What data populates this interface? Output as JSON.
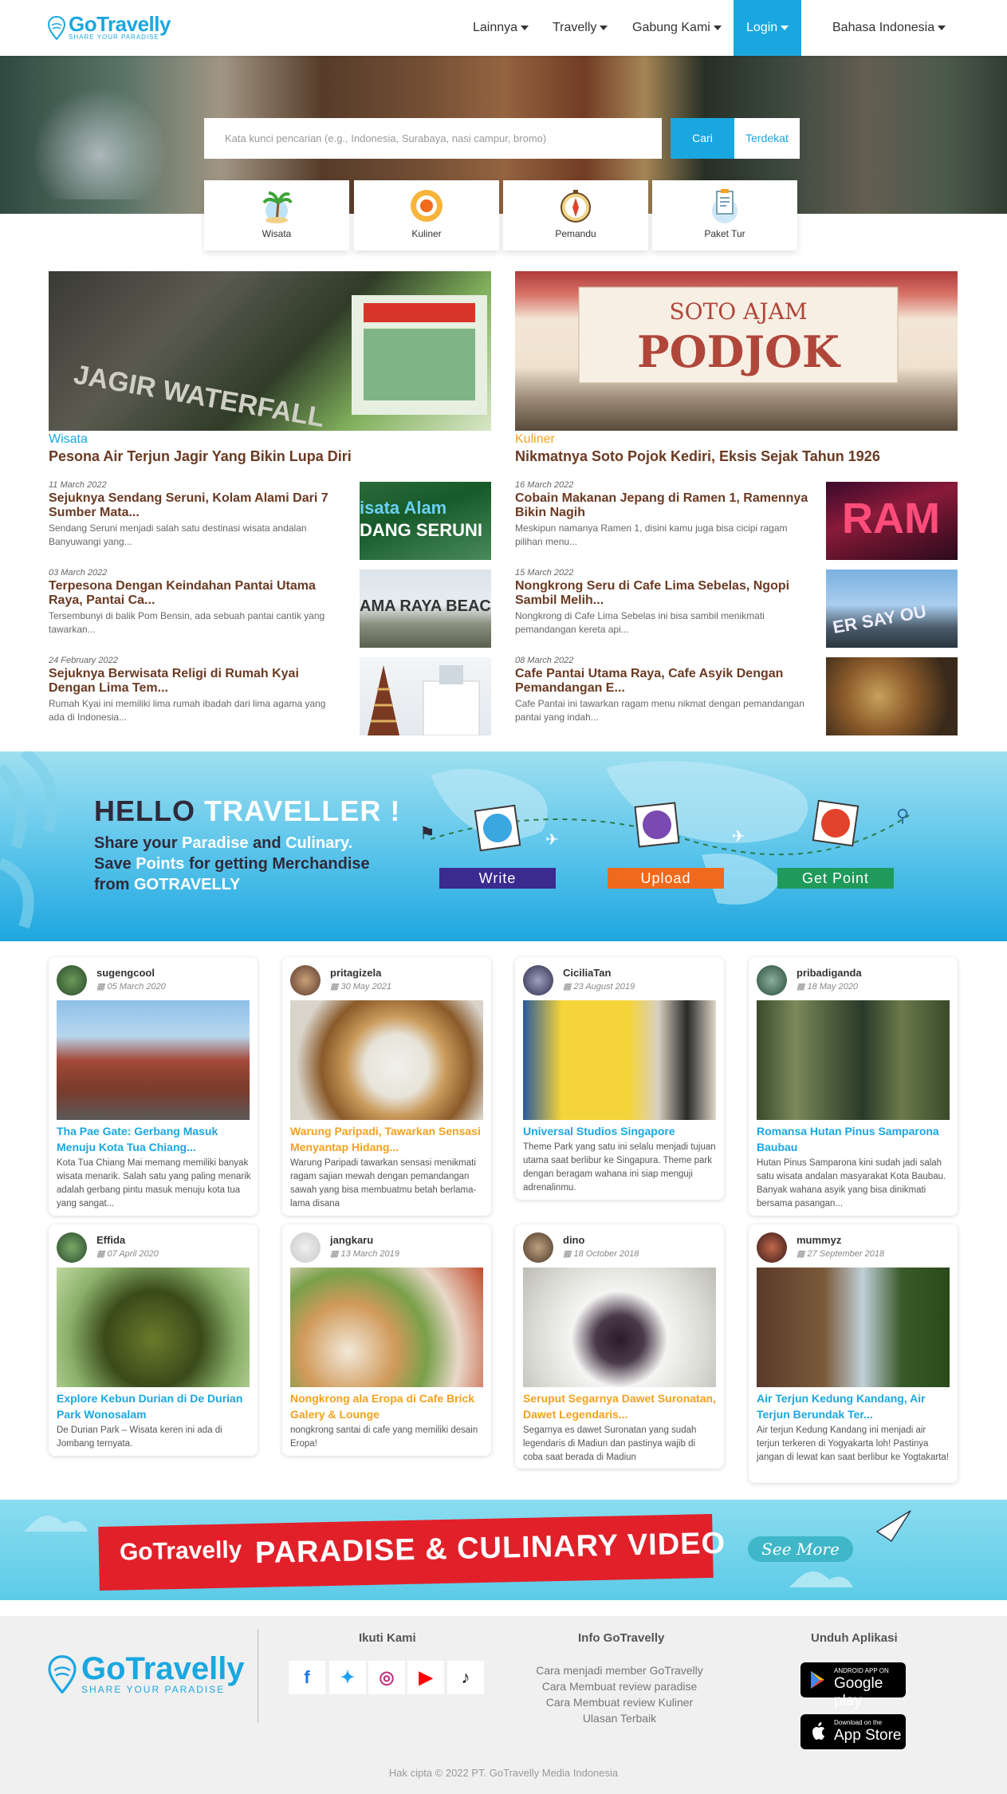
{
  "brand": {
    "name": "GoTravelly",
    "tagline": "SHARE YOUR PARADISE"
  },
  "nav": {
    "items": [
      "Lainnya",
      "Travelly",
      "Gabung Kami",
      "Login",
      "Bahasa Indonesia"
    ]
  },
  "search": {
    "placeholder": "Kata kunci pencarian (e.g., Indonesia, Surabaya, nasi campur, bromo)",
    "search_label": "Cari",
    "nearby_label": "Terdekat"
  },
  "categories": [
    {
      "label": "Wisata",
      "icon": "palm-tree-icon"
    },
    {
      "label": "Kuliner",
      "icon": "food-icon"
    },
    {
      "label": "Pemandu",
      "icon": "compass-icon"
    },
    {
      "label": "Paket Tur",
      "icon": "clipboard-globe-icon"
    }
  ],
  "featured": {
    "left": {
      "category": "Wisata",
      "category_color": "#1aa7e0",
      "title": "Pesona Air Terjun Jagir Yang Bikin Lupa Diri",
      "image_text": "JAGIR WATERFALL",
      "items": [
        {
          "date": "11 March 2022",
          "title": "Sejuknya Sendang Seruni, Kolam Alami Dari 7 Sumber Mata...",
          "desc": "Sendang Seruni menjadi salah satu destinasi wisata andalan Banyuwangi yang..."
        },
        {
          "date": "03 March 2022",
          "title": "Terpesona Dengan Keindahan Pantai Utama Raya, Pantai Ca...",
          "desc": "Tersembunyi di balik Pom Bensin, ada sebuah pantai cantik yang tawarkan..."
        },
        {
          "date": "24 February 2022",
          "title": "Sejuknya Berwisata Religi di Rumah Kyai Dengan Lima Tem...",
          "desc": "Rumah Kyai ini memiliki lima rumah ibadah dari lima agama yang ada di Indonesia..."
        }
      ]
    },
    "right": {
      "category": "Kuliner",
      "category_color": "#f4a11d",
      "title": "Nikmatnya Soto Pojok Kediri, Eksis Sejak Tahun 1926",
      "image_text_top": "SOTO AJAM",
      "image_text_main": "PODJOK",
      "items": [
        {
          "date": "16 March 2022",
          "title": "Cobain Makanan Jepang di Ramen 1, Ramennya Bikin Nagih",
          "desc": "Meskipun namanya Ramen 1, disini kamu juga bisa cicipi ragam pilihan menu..."
        },
        {
          "date": "15 March 2022",
          "title": "Nongkrong Seru di Cafe Lima Sebelas, Ngopi Sambil Melih...",
          "desc": "Nongkrong di Cafe Lima Sebelas ini bisa sambil menikmati pemandangan kereta api..."
        },
        {
          "date": "08 March 2022",
          "title": "Cafe Pantai Utama Raya, Cafe Asyik Dengan Pemandangan E...",
          "desc": "Cafe Pantai ini tawarkan ragam menu nikmat dengan pemandangan pantai yang indah..."
        }
      ]
    }
  },
  "banner": {
    "hello": "HELLO",
    "traveller": "TRAVELLER !",
    "line1_a": "Share your ",
    "line1_b": "Paradise",
    "line1_c": " and ",
    "line1_d": "Culinary.",
    "line2_a": "Save ",
    "line2_b": "Points",
    "line2_c": " for getting ",
    "line2_d": "Merchandise",
    "line3_a": "from ",
    "line3_b": "GOTRAVELLY",
    "buttons": [
      {
        "label": "Write",
        "color": "#3b2a8f"
      },
      {
        "label": "Upload",
        "color": "#f06a1e"
      },
      {
        "label": "Get Point",
        "color": "#1f9a5a"
      }
    ]
  },
  "posts": [
    {
      "user": "sugengcool",
      "date": "05 March 2020",
      "title": "Tha Pae Gate: Gerbang Masuk Menuju Kota Tua Chiang...",
      "color": "#1aa7e0",
      "desc": "Kota Tua Chiang Mai memang memiliki banyak wisata menarik. Salah satu yang paling menarik adalah gerbang pintu masuk menuju kota tua yang sangat..."
    },
    {
      "user": "pritagizela",
      "date": "30 May 2021",
      "title": "Warung Paripadi, Tawarkan Sensasi Menyantap Hidang...",
      "color": "#f4a11d",
      "desc": "Warung Paripadi tawarkan sensasi menikmati ragam sajian mewah dengan pemandangan sawah yang bisa membuatmu betah berlama-lama disana"
    },
    {
      "user": "CiciliaTan",
      "date": "23 August 2019",
      "title": "Universal Studios Singapore",
      "color": "#1aa7e0",
      "desc": "Theme Park yang satu ini selalu menjadi tujuan utama saat berlibur ke Singapura. Theme park dengan beragam wahana ini siap menguji adrenalinmu."
    },
    {
      "user": "pribadiganda",
      "date": "18 May 2020",
      "title": "Romansa Hutan Pinus Samparona Baubau",
      "color": "#1aa7e0",
      "desc": "Hutan Pinus Samparona kini sudah jadi salah satu wisata andalan masyarakat Kota Baubau. Banyak wahana asyik yang bisa dinikmati bersama pasangan..."
    },
    {
      "user": "Effida",
      "date": "07 April 2020",
      "title": "Explore Kebun Durian di De Durian Park Wonosalam",
      "color": "#1aa7e0",
      "desc": "De Durian Park – Wisata keren ini ada di Jombang ternyata."
    },
    {
      "user": "jangkaru",
      "date": "13 March 2019",
      "title": "Nongkrong ala Eropa di Cafe Brick Galery & Lounge",
      "color": "#f4a11d",
      "desc": "nongkrong santai di cafe yang memiliki desain Eropa!"
    },
    {
      "user": "dino",
      "date": "18 October 2018",
      "title": "Seruput Segarnya Dawet Suronatan, Dawet Legendaris...",
      "color": "#f4a11d",
      "desc": "Segarnya es dawet Suronatan yang sudah legendaris di Madiun dan pastinya wajib di coba saat berada di Madiun"
    },
    {
      "user": "mummyz",
      "date": "27 September 2018",
      "title": "Air Terjun Kedung Kandang, Air Terjun Berundak Ter...",
      "color": "#1aa7e0",
      "desc": "Air terjun Kedung Kandang ini menjadi air terjun terkeren di Yogyakarta loh! Pastinya jangan di lewat kan saat berlibur ke Yogtakarta!"
    }
  ],
  "video_banner": {
    "logo": "GoTravelly",
    "logo_tag": "SHARE YOUR PARADISE",
    "title": "PARADISE & CULINARY VIDEO",
    "cta": "See More"
  },
  "footer": {
    "follow_title": "Ikuti Kami",
    "social": [
      {
        "icon": "facebook-icon",
        "glyph": "f",
        "color": "#1877f2"
      },
      {
        "icon": "twitter-icon",
        "glyph": "✦",
        "color": "#1da1f2"
      },
      {
        "icon": "instagram-icon",
        "glyph": "◎",
        "color": "#c13584"
      },
      {
        "icon": "youtube-icon",
        "glyph": "▶",
        "color": "#ff0000"
      },
      {
        "icon": "tiktok-icon",
        "glyph": "♪",
        "color": "#111111"
      }
    ],
    "info_title": "Info GoTravelly",
    "info_links": [
      "Cara menjadi member GoTravelly",
      "Cara Membuat review paradise",
      "Cara Membuat review Kuliner",
      "Ulasan Terbaik"
    ],
    "app_title": "Unduh Aplikasi",
    "google": {
      "small": "ANDROID APP ON",
      "big": "Google play"
    },
    "apple": {
      "small": "Download on the",
      "big": "App Store"
    },
    "copyright": "Hak cipta © 2022 PT. GoTravelly Media Indonesia"
  }
}
